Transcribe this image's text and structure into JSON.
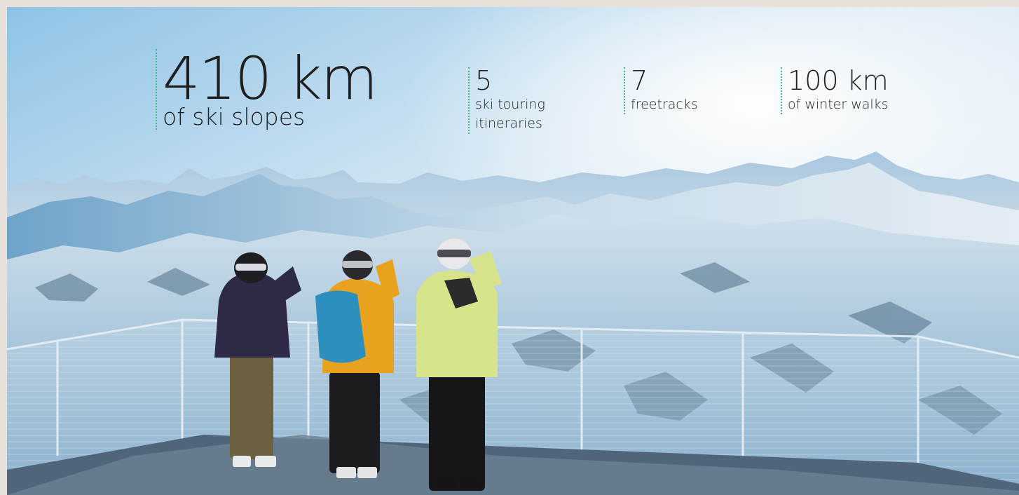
{
  "stats": {
    "main": {
      "value": "410 km",
      "label": "of ski slopes"
    },
    "touring": {
      "value": "5",
      "label": "ski touring itineraries"
    },
    "freetracks": {
      "value": "7",
      "label": "freetracks"
    },
    "walks": {
      "value": "100 km",
      "label": "of winter walks"
    }
  },
  "colors": {
    "accent_dotted_line": "#3fb58c",
    "text": "#1f1f1f",
    "frame_background": "#e8e1d9",
    "sky": "#cfe4f2",
    "snow": "#eef4f9",
    "jacket_purple": "#2e2a45",
    "jacket_yellow": "#e9a21e",
    "backpack_blue": "#2d8fbe",
    "jacket_lime": "#d8e48c"
  },
  "photo": {
    "subject": "three-skiers-on-mountain-viewing-platform"
  }
}
